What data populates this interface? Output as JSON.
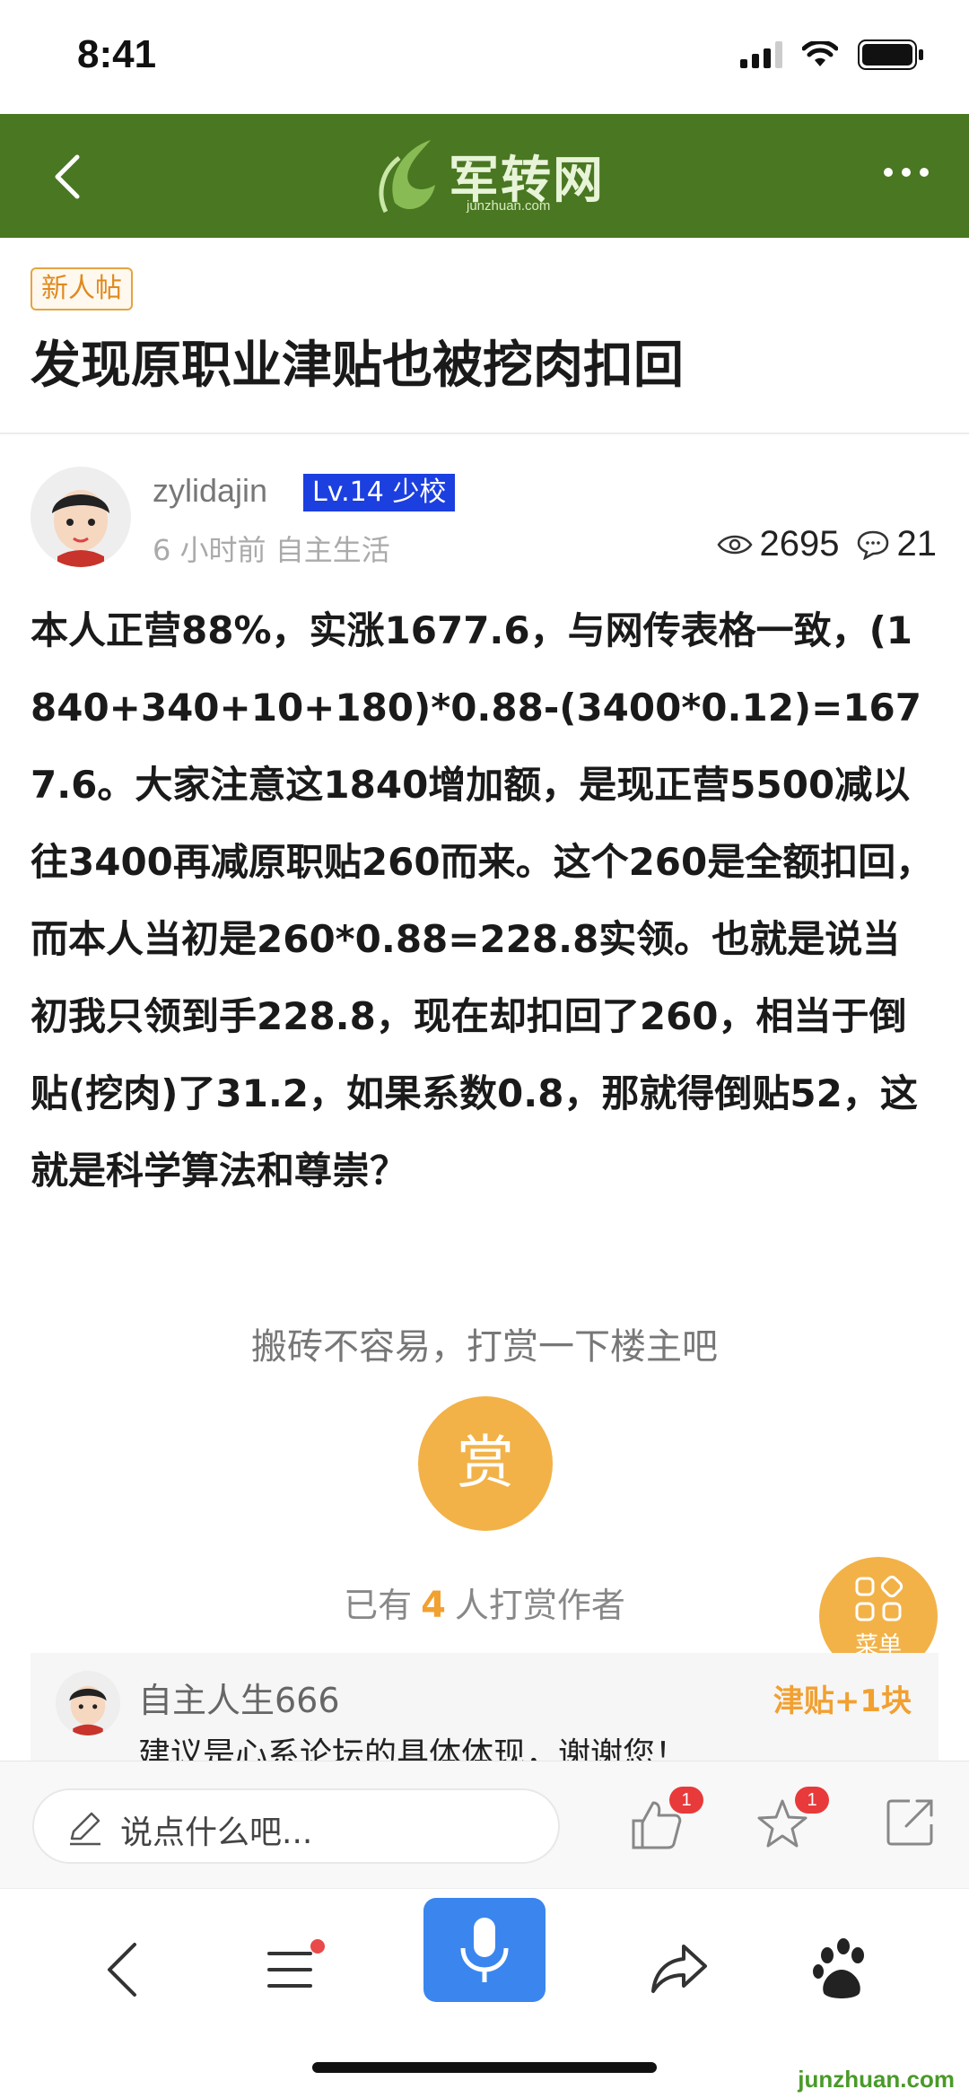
{
  "status_bar": {
    "time": "8:41"
  },
  "header": {
    "logo_text": "军转网",
    "logo_sub": "junzhuan.com"
  },
  "post": {
    "tag": "新人帖",
    "title": "发现原职业津贴也被挖肉扣回",
    "author": "zylidajin",
    "level": "Lv.14 少校",
    "meta": "6 小时前 自主生活",
    "views": "2695",
    "comments": "21",
    "body": "本人正营88%，实涨1677.6，与网传表格一致，(1840+340+10+180)*0.88-(3400*0.12)=1677.6。大家注意这1840增加额，是现正营5500减以往3400再减原职贴260而来。这个260是全额扣回，而本人当初是260*0.88=228.8实领。也就是说当初我只领到手228.8，现在却扣回了260，相当于倒贴(挖肉)了31.2，如果系数0.8，那就得倒贴52，这就是科学算法和尊崇？"
  },
  "reward": {
    "prompt": "搬砖不容易，打赏一下楼主吧",
    "button": "赏",
    "count_prefix": "已有",
    "count": "4",
    "count_suffix": "人打赏作者",
    "item": {
      "name": "自主人生666",
      "amount": "津贴+1块",
      "text": "建议是心系论坛的具体体现，谢谢您！"
    }
  },
  "menu_fab": {
    "label": "菜单"
  },
  "comment_bar": {
    "placeholder": "说点什么吧...",
    "like_badge": "1",
    "fav_badge": "1"
  },
  "watermark": "junzhuan.com"
}
